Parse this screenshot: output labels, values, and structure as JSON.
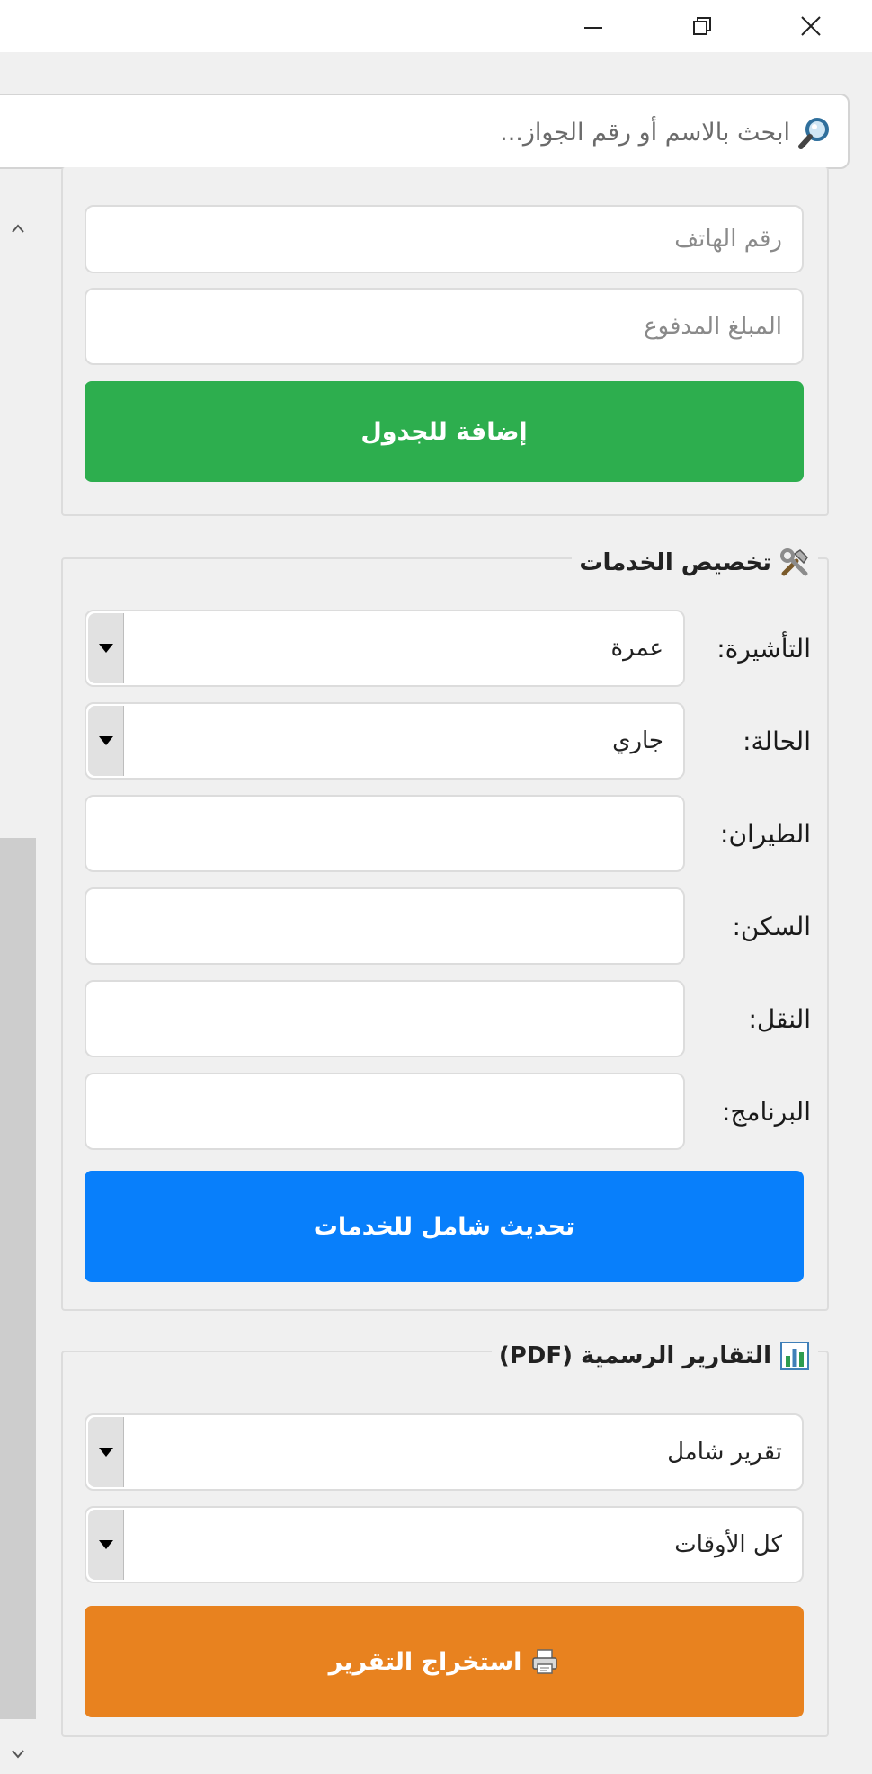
{
  "window": {
    "minimize_icon": "minimize-icon",
    "restore_icon": "restore-icon",
    "close_icon": "close-icon"
  },
  "search": {
    "placeholder": "ابحث بالاسم أو رقم الجواز...",
    "icon": "search-icon"
  },
  "client_form": {
    "phone_placeholder": "رقم الهاتف",
    "amount_placeholder": "المبلغ المدفوع",
    "add_button": "إضافة للجدول"
  },
  "services": {
    "title": "تخصيص الخدمات",
    "title_icon": "tools-icon",
    "visa_label": "التأشيرة:",
    "visa_value": "عمرة",
    "status_label": "الحالة:",
    "status_value": "جاري",
    "flight_label": "الطيران:",
    "housing_label": "السكن:",
    "transport_label": "النقل:",
    "program_label": "البرنامج:",
    "update_button": "تحديث شامل للخدمات"
  },
  "reports": {
    "title": "التقارير الرسمية (PDF)",
    "title_icon": "bar-chart-icon",
    "report_type": "تقرير شامل",
    "period": "كل الأوقات",
    "export_button": "استخراج التقرير",
    "export_icon": "printer-icon"
  },
  "colors": {
    "green": "#2dae4e",
    "blue": "#087ffb",
    "orange": "#e8821f"
  }
}
